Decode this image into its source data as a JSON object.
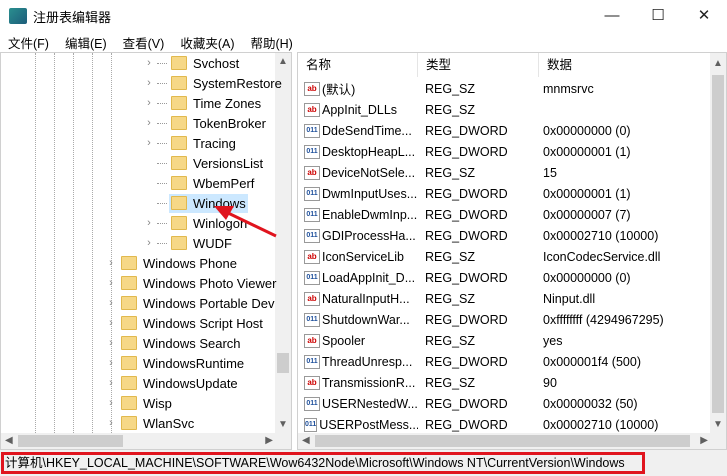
{
  "window": {
    "title": "注册表编辑器",
    "minimize": "—",
    "maximize": "☐",
    "close": "✕"
  },
  "menu": [
    "文件(F)",
    "编辑(E)",
    "查看(V)",
    "收藏夹(A)",
    "帮助(H)"
  ],
  "tree": {
    "inner": [
      {
        "label": "Svchost",
        "expandable": true
      },
      {
        "label": "SystemRestore",
        "expandable": true
      },
      {
        "label": "Time Zones",
        "expandable": true
      },
      {
        "label": "TokenBroker",
        "expandable": true
      },
      {
        "label": "Tracing",
        "expandable": true
      },
      {
        "label": "VersionsList",
        "expandable": false
      },
      {
        "label": "WbemPerf",
        "expandable": false
      },
      {
        "label": "Windows",
        "expandable": false,
        "selected": true
      },
      {
        "label": "Winlogon",
        "expandable": true
      },
      {
        "label": "WUDF",
        "expandable": true
      }
    ],
    "outer": [
      {
        "label": "Windows Phone"
      },
      {
        "label": "Windows Photo Viewer"
      },
      {
        "label": "Windows Portable Dev"
      },
      {
        "label": "Windows Script Host"
      },
      {
        "label": "Windows Search"
      },
      {
        "label": "WindowsRuntime"
      },
      {
        "label": "WindowsUpdate"
      },
      {
        "label": "Wisp"
      },
      {
        "label": "WlanSvc"
      }
    ]
  },
  "list": {
    "columns": [
      "名称",
      "类型",
      "数据"
    ],
    "rows": [
      {
        "name": "(默认)",
        "type": "REG_SZ",
        "data": "mnmsrvc",
        "icon": "sz"
      },
      {
        "name": "AppInit_DLLs",
        "type": "REG_SZ",
        "data": "",
        "icon": "sz"
      },
      {
        "name": "DdeSendTime...",
        "type": "REG_DWORD",
        "data": "0x00000000 (0)",
        "icon": "dw"
      },
      {
        "name": "DesktopHeapL...",
        "type": "REG_DWORD",
        "data": "0x00000001 (1)",
        "icon": "dw"
      },
      {
        "name": "DeviceNotSele...",
        "type": "REG_SZ",
        "data": "15",
        "icon": "sz"
      },
      {
        "name": "DwmInputUses...",
        "type": "REG_DWORD",
        "data": "0x00000001 (1)",
        "icon": "dw"
      },
      {
        "name": "EnableDwmInp...",
        "type": "REG_DWORD",
        "data": "0x00000007 (7)",
        "icon": "dw"
      },
      {
        "name": "GDIProcessHa...",
        "type": "REG_DWORD",
        "data": "0x00002710 (10000)",
        "icon": "dw"
      },
      {
        "name": "IconServiceLib",
        "type": "REG_SZ",
        "data": "IconCodecService.dll",
        "icon": "sz"
      },
      {
        "name": "LoadAppInit_D...",
        "type": "REG_DWORD",
        "data": "0x00000000 (0)",
        "icon": "dw"
      },
      {
        "name": "NaturalInputH...",
        "type": "REG_SZ",
        "data": "Ninput.dll",
        "icon": "sz"
      },
      {
        "name": "ShutdownWar...",
        "type": "REG_DWORD",
        "data": "0xffffffff (4294967295)",
        "icon": "dw"
      },
      {
        "name": "Spooler",
        "type": "REG_SZ",
        "data": "yes",
        "icon": "sz"
      },
      {
        "name": "ThreadUnresp...",
        "type": "REG_DWORD",
        "data": "0x000001f4 (500)",
        "icon": "dw"
      },
      {
        "name": "TransmissionR...",
        "type": "REG_SZ",
        "data": "90",
        "icon": "sz"
      },
      {
        "name": "USERNestedW...",
        "type": "REG_DWORD",
        "data": "0x00000032 (50)",
        "icon": "dw"
      },
      {
        "name": "USERPostMess...",
        "type": "REG_DWORD",
        "data": "0x00002710 (10000)",
        "icon": "dw"
      }
    ]
  },
  "icons": {
    "sz": "ab",
    "dw": "011"
  },
  "status": {
    "path": "计算机\\HKEY_LOCAL_MACHINE\\SOFTWARE\\Wow6432Node\\Microsoft\\Windows NT\\CurrentVersion\\Windows"
  },
  "colors": {
    "highlight": "#e0141e",
    "selection": "#cce8ff"
  }
}
